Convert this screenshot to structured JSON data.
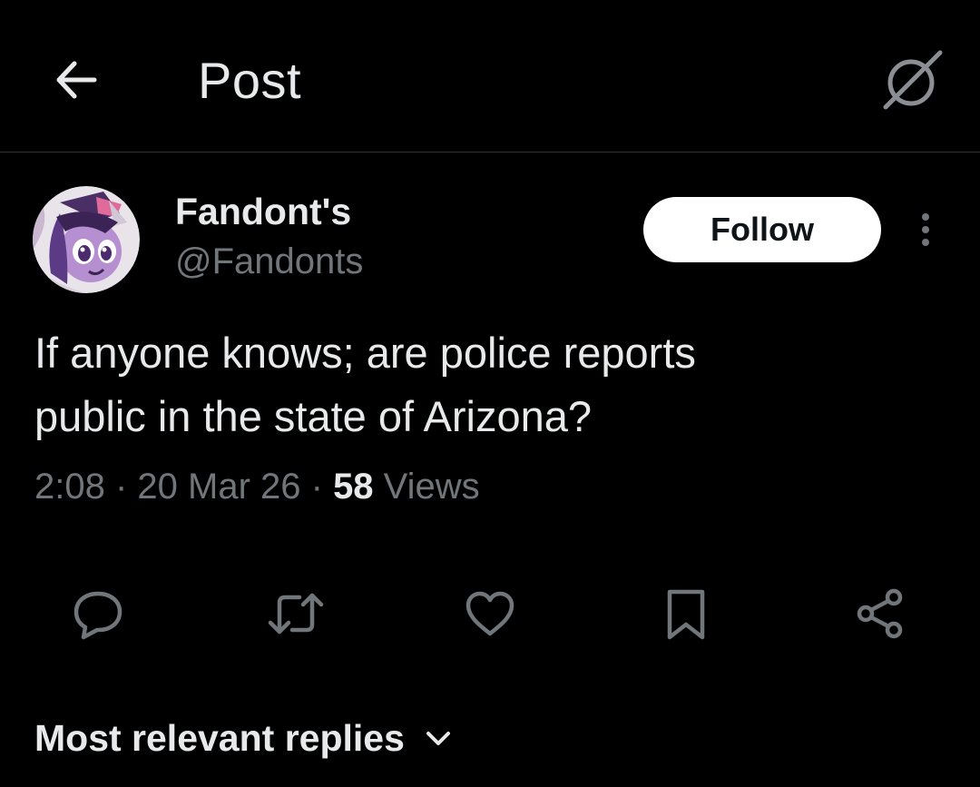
{
  "header": {
    "title": "Post",
    "back_icon": "arrow-left-icon",
    "grok_icon": "grok-icon"
  },
  "author": {
    "display_name": "Fandont's",
    "handle": "@Fandonts",
    "avatar_icon": "avatar-image"
  },
  "follow_button": {
    "label": "Follow"
  },
  "more_icon": "more-vertical-icon",
  "post": {
    "text": "If anyone knows; are police reports\npublic in the state of Arizona?",
    "time": "2:08",
    "date": "20 Mar 26",
    "separator": " · ",
    "views_count": "58",
    "views_label": " Views"
  },
  "actions": [
    {
      "name": "reply",
      "icon": "reply-icon"
    },
    {
      "name": "repost",
      "icon": "repost-icon"
    },
    {
      "name": "like",
      "icon": "heart-icon"
    },
    {
      "name": "bookmark",
      "icon": "bookmark-icon"
    },
    {
      "name": "share",
      "icon": "share-icon"
    }
  ],
  "replies_sort": {
    "label": "Most relevant replies",
    "icon": "chevron-down-icon"
  },
  "colors": {
    "background": "#000000",
    "primary_text": "#e7e9ea",
    "secondary_text": "#71767b",
    "divider": "#2f3336",
    "follow_bg": "#ffffff",
    "follow_text": "#0f1419"
  }
}
